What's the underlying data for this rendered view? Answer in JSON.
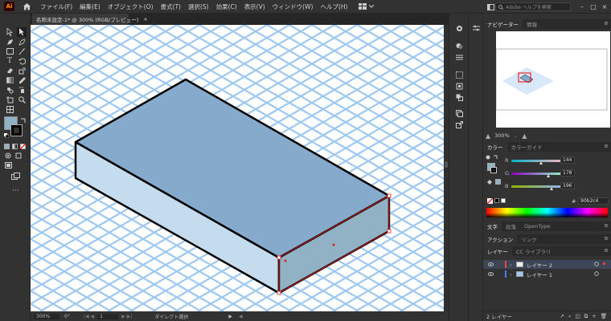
{
  "app": {
    "logo": "Ai"
  },
  "menu": [
    "ファイル(F)",
    "編集(E)",
    "オブジェクト(O)",
    "書式(T)",
    "選択(S)",
    "効果(C)",
    "表示(V)",
    "ウィンドウ(W)",
    "ヘルプ(H)"
  ],
  "search": {
    "placeholder": "Adobe ヘルプを検索"
  },
  "document": {
    "tab_title": "名称未設定-1* @ 300% (RGB/プレビュー)",
    "close": "×"
  },
  "status": {
    "zoom": "300%",
    "rotation": "0°",
    "artboard": "1",
    "tool": "ダイレクト選択"
  },
  "navigator": {
    "tabs": [
      "ナビゲーター",
      "情報"
    ],
    "zoom": "300%"
  },
  "color_panel": {
    "tabs": [
      "カラー",
      "カラーガイド"
    ],
    "r_label": "R",
    "r_value": "144",
    "r": 144,
    "g_label": "G",
    "g_value": "178",
    "g": 178,
    "b_label": "B",
    "b_value": "196",
    "b": 196,
    "hex_label": "#",
    "hex_value": "90b2c4",
    "fill_color": "#90b2c4"
  },
  "char_panel": {
    "tabs": [
      "文字",
      "段落",
      "OpenType"
    ]
  },
  "action_panel": {
    "tabs": [
      "アクション",
      "リンク"
    ]
  },
  "layers_panel": {
    "tabs": [
      "レイヤー",
      "CC ライブラリ"
    ],
    "layers": [
      {
        "name": "レイヤー 2",
        "color": "#ff3b3b",
        "selected": true
      },
      {
        "name": "レイヤー 1",
        "color": "#4a7bff",
        "selected": false
      }
    ],
    "footer": "2 レイヤー"
  },
  "colors": {
    "box_top": "#85aacc",
    "box_left": "#c5dcef",
    "box_right": "#90b2c4",
    "grid": "#9ec8f0"
  }
}
